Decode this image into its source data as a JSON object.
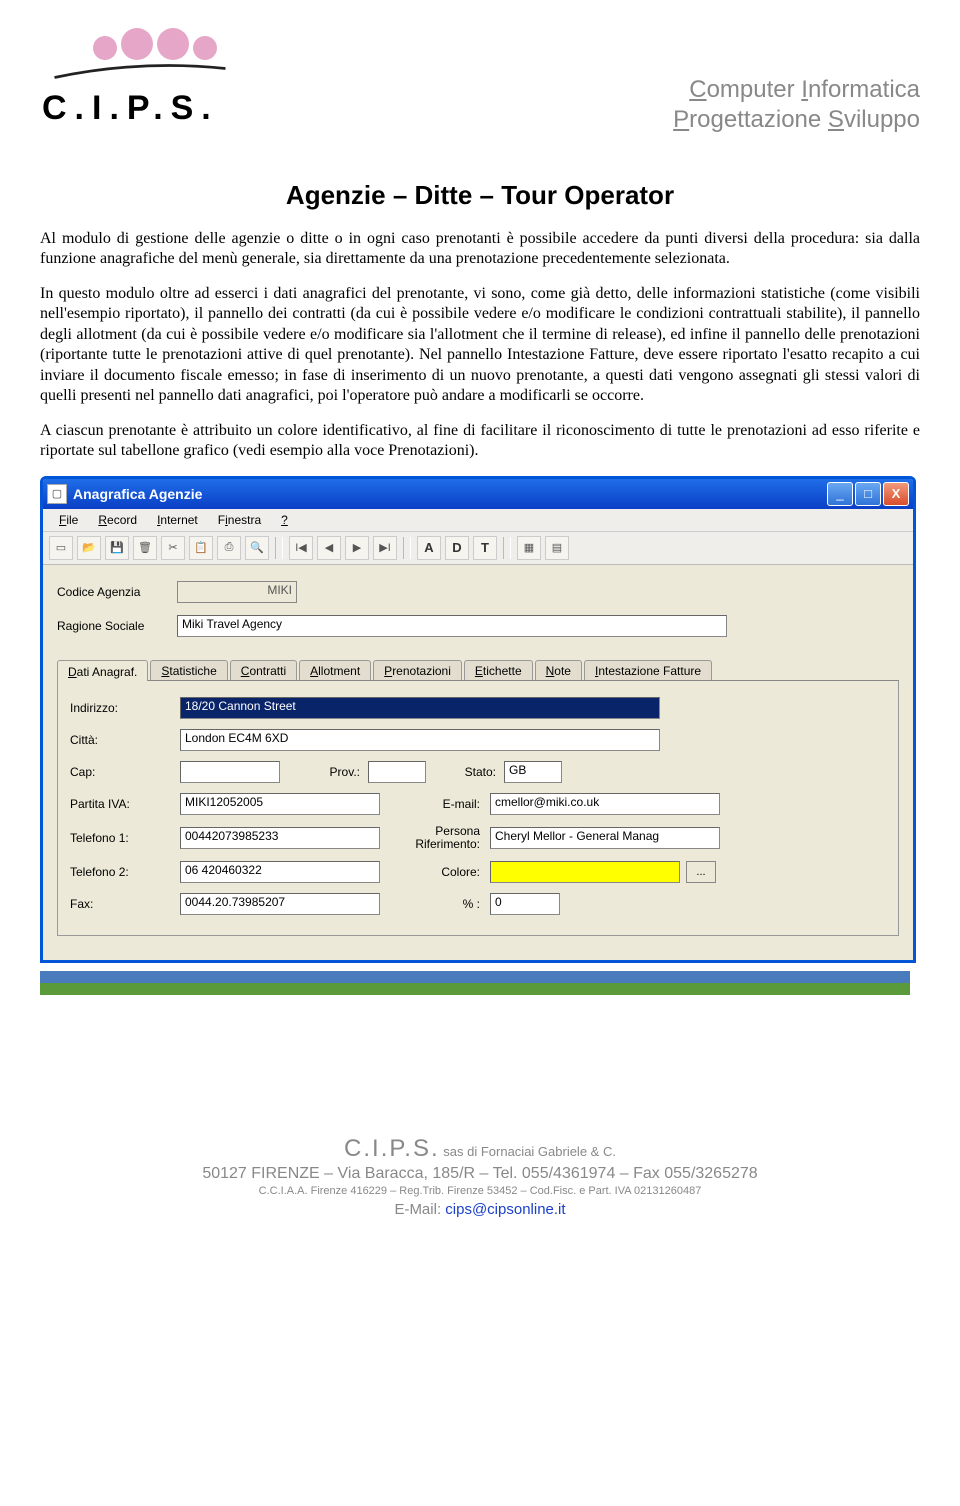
{
  "header": {
    "logo_text": "C.I.P.S.",
    "tagline_line1_parts": [
      "C",
      "omputer ",
      "I",
      "nformatica"
    ],
    "tagline_line2_parts": [
      "P",
      "rogettazione ",
      "S",
      "viluppo"
    ]
  },
  "doc": {
    "title": "Agenzie – Ditte – Tour Operator",
    "p1": "Al modulo di gestione delle agenzie o ditte o in ogni caso prenotanti è possibile accedere da punti diversi della procedura: sia dalla funzione anagrafiche del menù generale, sia direttamente da una prenotazione precedentemente selezionata.",
    "p2": "In questo modulo oltre ad esserci i dati anagrafici del prenotante, vi sono, come già detto, delle informazioni statistiche (come visibili nell'esempio riportato), il pannello dei contratti (da cui è possibile vedere e/o modificare le condizioni contrattuali stabilite), il pannello degli allotment (da cui è possibile vedere e/o modificare sia l'allotment che il termine di release), ed infine il pannello delle prenotazioni (riportante tutte le prenotazioni attive di quel prenotante). Nel pannello Intestazione Fatture, deve essere riportato l'esatto recapito a cui inviare il documento fiscale emesso; in fase di inserimento di un nuovo prenotante, a questi dati vengono assegnati gli stessi valori di quelli presenti nel pannello dati anagrafici, poi l'operatore può andare a modificarli se occorre.",
    "p3": "A ciascun prenotante è attribuito un colore identificativo, al fine di facilitare il riconoscimento di tutte le prenotazioni ad esso riferite e riportate sul tabellone grafico (vedi esempio alla voce Prenotazioni)."
  },
  "win": {
    "title": "Anagrafica Agenzie",
    "menu": [
      "File",
      "Record",
      "Internet",
      "Finestra",
      "?"
    ],
    "nav_letters": [
      "A",
      "D",
      "T"
    ],
    "fields": {
      "codice_label": "Codice Agenzia",
      "codice_value": "MIKI",
      "ragione_label": "Ragione Sociale",
      "ragione_value": "Miki Travel Agency"
    },
    "tabs": [
      "Dati Anagraf.",
      "Statistiche",
      "Contratti",
      "Allotment",
      "Prenotazioni",
      "Etichette",
      "Note",
      "Intestazione Fatture"
    ],
    "form": {
      "indirizzo_label": "Indirizzo:",
      "indirizzo_value": "18/20 Cannon Street",
      "citta_label": "Città:",
      "citta_value": "London EC4M 6XD",
      "cap_label": "Cap:",
      "cap_value": "",
      "prov_label": "Prov.:",
      "prov_value": "",
      "stato_label": "Stato:",
      "stato_value": "GB",
      "piva_label": "Partita IVA:",
      "piva_value": "MIKI12052005",
      "email_label": "E-mail:",
      "email_value": "cmellor@miki.co.uk",
      "tel1_label": "Telefono 1:",
      "tel1_value": "00442073985233",
      "persona_label": "Persona Riferimento:",
      "persona_value": "Cheryl Mellor - General Manag",
      "tel2_label": "Telefono 2:",
      "tel2_value": "06 420460322",
      "colore_label": "Colore:",
      "colore_btn": "...",
      "fax_label": "Fax:",
      "fax_value": "0044.20.73985207",
      "perc_label": "% :",
      "perc_value": "0"
    }
  },
  "footer": {
    "company_big": "C.I.P.S.",
    "company_suffix": " sas ",
    "company_tail": "di Fornaciai Gabriele & C.",
    "addr": "50127 FIRENZE – Via Baracca, 185/R – Tel. 055/4361974 – Fax 055/3265278",
    "legal": "C.C.I.A.A. Firenze 416229 – Reg.Trib. Firenze 53452 – Cod.Fisc. e Part. IVA 02131260487",
    "email_label": "E-Mail: ",
    "email_value": "cips@cipsonline.it"
  }
}
